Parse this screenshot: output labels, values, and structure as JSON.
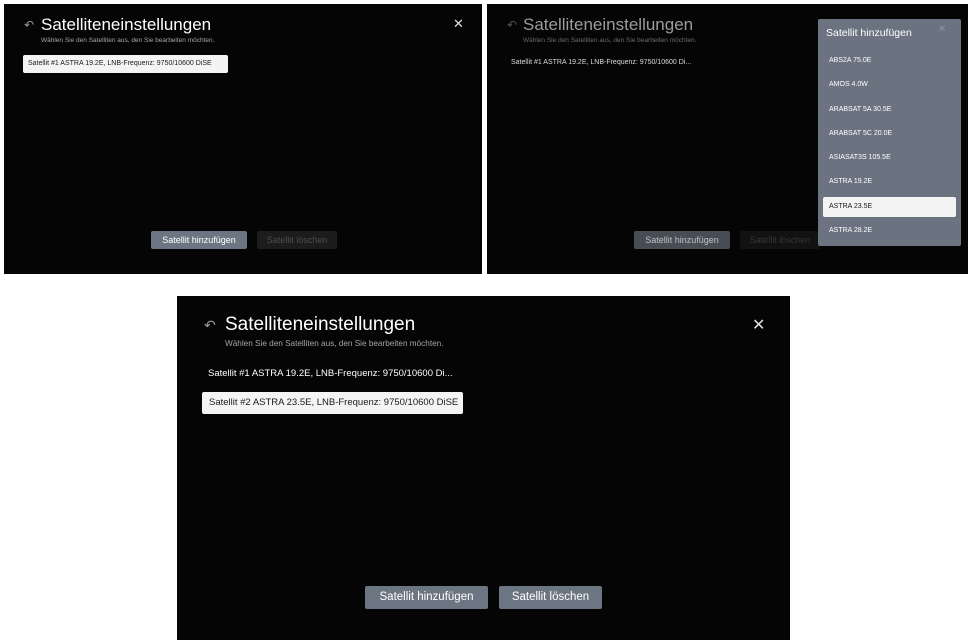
{
  "screen1": {
    "title": "Satelliteneinstellungen",
    "subtitle": "Wählen Sie den Satelliten aus, den Sie bearbeiten möchten.",
    "items": [
      "Satellit #1 ASTRA 19.2E, LNB-Frequenz: 9750/10600 DiSE"
    ],
    "add_button": "Satellit hinzufügen",
    "delete_button": "Satellit löschen"
  },
  "screen2": {
    "title": "Satelliteneinstellungen",
    "subtitle": "Wählen Sie den Satelliten aus, den Sie bearbeiten möchten.",
    "items": [
      "Satellit #1 ASTRA 19.2E, LNB-Frequenz: 9750/10600 Di..."
    ],
    "add_button": "Satellit hinzufügen",
    "delete_button": "Satellit löschen",
    "dropdown": {
      "title": "Satellit hinzufügen",
      "options": [
        "ABS2A 75.0E",
        "AMOS 4.0W",
        "ARABSAT 5A 30.5E",
        "ARABSAT 5C 20.0E",
        "ASIASAT3S 105.5E",
        "ASTRA 19.2E",
        "ASTRA 23.5E",
        "ASTRA 28.2E"
      ],
      "selected_index": 6
    }
  },
  "screen3": {
    "title": "Satelliteneinstellungen",
    "subtitle": "Wählen Sie den Satelliten aus, den Sie bearbeiten möchten.",
    "items": [
      "Satellit #1 ASTRA 19.2E, LNB-Frequenz: 9750/10600 Di...",
      "Satellit #2 ASTRA 23.5E, LNB-Frequenz: 9750/10600 DiSE"
    ],
    "add_button": "Satellit hinzufügen",
    "delete_button": "Satellit löschen"
  },
  "icons": {
    "back": "back-arrow-icon",
    "close": "close-icon"
  },
  "colors": {
    "background": "#050505",
    "button_active": "#6c7683",
    "dropdown_bg": "#6b7381",
    "focus_bg": "#f4f4f4"
  }
}
